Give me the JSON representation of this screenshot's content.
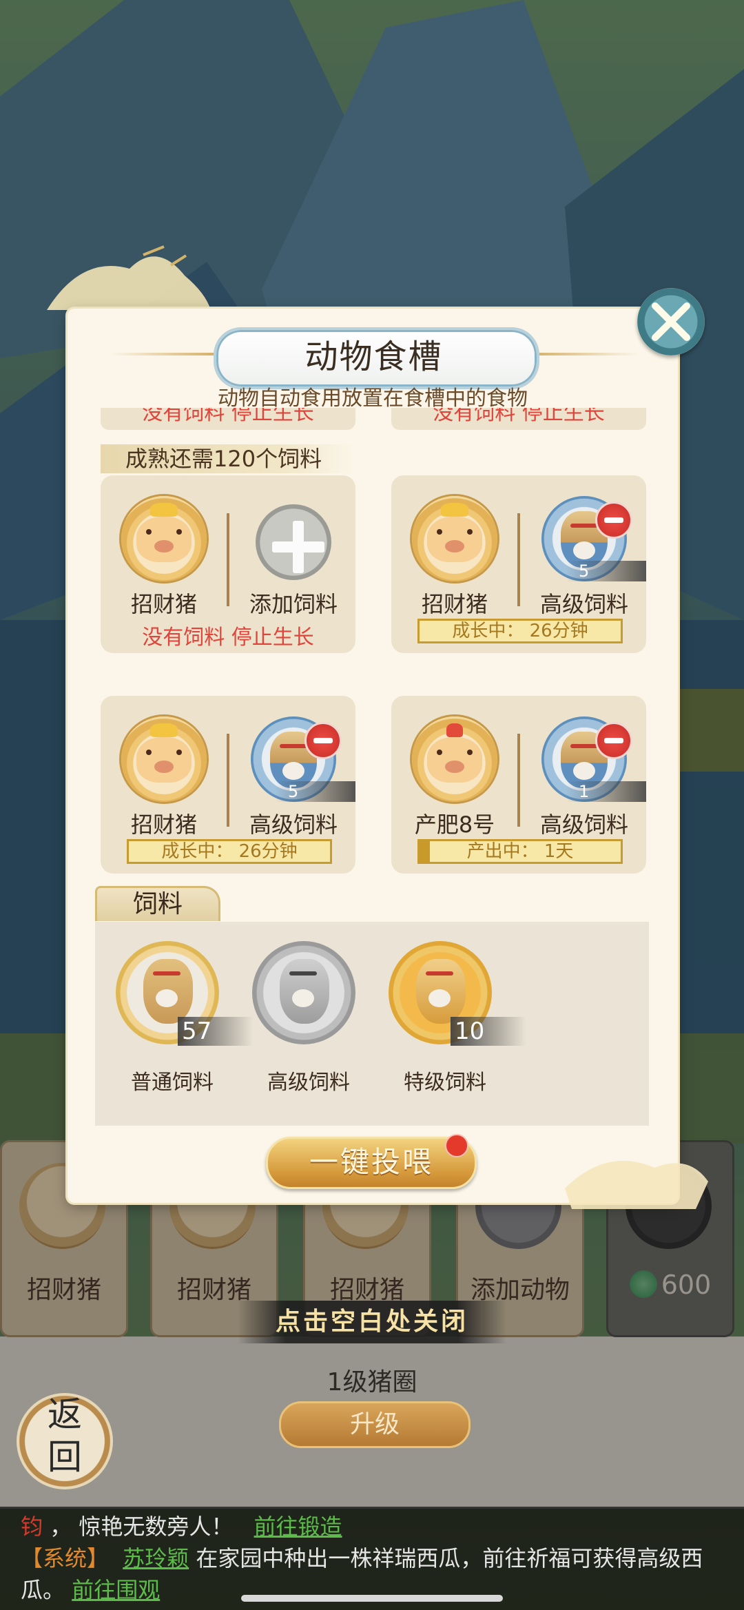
{
  "modal": {
    "title": "动物食槽",
    "subtitle": "动物自动食用放置在食槽中的食物",
    "cut_status_left": "没有饲料 停止生长",
    "cut_status_right": "没有饲料 停止生长",
    "mature_tag": "成熟还需120个饲料",
    "troughs": [
      {
        "animal": "招财猪",
        "feed": "添加饲料",
        "feed_qty": "",
        "status": "没有饲料 停止生长",
        "status_type": "stopped"
      },
      {
        "animal": "招财猪",
        "feed": "高级饲料",
        "feed_qty": "5",
        "status": "成长中： 26分钟",
        "status_type": "growing",
        "progress": 0.0
      },
      {
        "animal": "招财猪",
        "feed": "高级饲料",
        "feed_qty": "5",
        "status": "成长中： 26分钟",
        "status_type": "growing",
        "progress": 0.0
      },
      {
        "animal": "产肥8号",
        "feed": "高级饲料",
        "feed_qty": "1",
        "status": "产出中： 1天",
        "status_type": "producing",
        "progress": 0.05
      }
    ],
    "feed_section_title": "饲料",
    "inventory": [
      {
        "name": "普通饲料",
        "qty": "57",
        "style": "common"
      },
      {
        "name": "高级饲料",
        "qty": "",
        "style": "gray"
      },
      {
        "name": "特级饲料",
        "qty": "10",
        "style": "special"
      }
    ],
    "feed_all_button": "一键投喂"
  },
  "background": {
    "pen_slots": [
      "招财猪",
      "招财猪",
      "招财猪",
      "添加动物"
    ],
    "locked_slot_cost": "600",
    "close_hint": "点击空白处关闭",
    "level_label": "1级猪圈",
    "upgrade_button": "升级",
    "back_button": [
      "返",
      "回"
    ]
  },
  "chat": {
    "line1_prefix": "钧",
    "line1_text": "， 惊艳无数旁人！",
    "line1_link": "前往锻造",
    "line2_tag": "【系统】",
    "line2_name": "苏玲颖",
    "line2_text": "在家园中种出一株祥瑞西瓜，前往祈福可获得高级西",
    "line3_text": "瓜。",
    "line3_link": "前往围观"
  },
  "colors": {
    "accent_gold": "#c99a2a",
    "warning_red": "#e0443a",
    "link_green": "#5cbc4a"
  }
}
